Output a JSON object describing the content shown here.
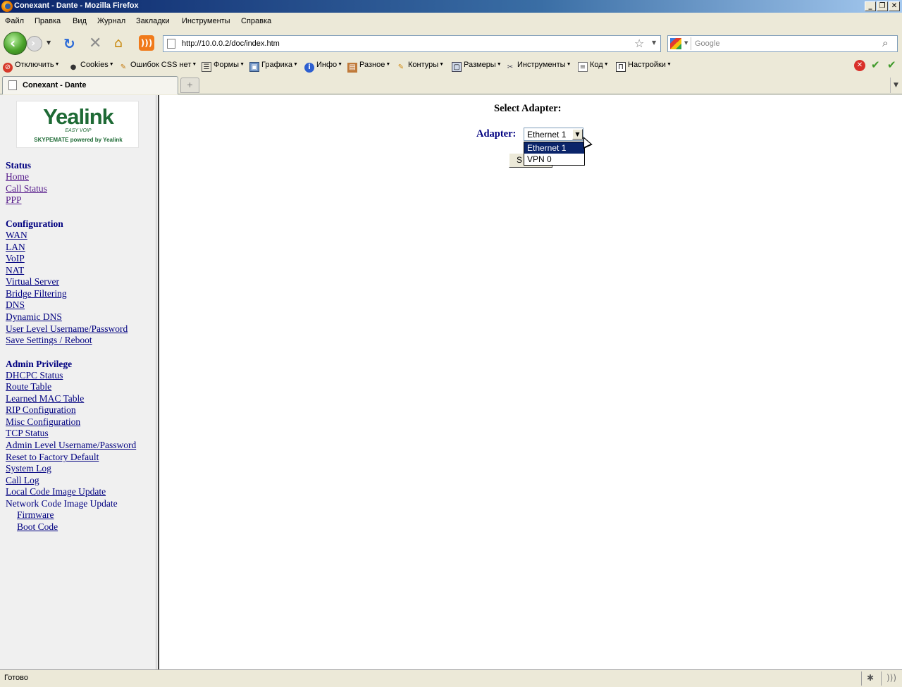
{
  "window": {
    "title": "Conexant - Dante - Mozilla Firefox"
  },
  "menu": [
    "Файл",
    "Правка",
    "Вид",
    "Журнал",
    "Закладки",
    "Инструменты",
    "Справка"
  ],
  "navigation": {
    "url": "http://10.0.0.2/doc/index.htm",
    "search_placeholder": "Google"
  },
  "toolbar": [
    "Отключить",
    "Cookies",
    "Ошибок CSS нет",
    "Формы",
    "Графика",
    "Инфо",
    "Разное",
    "Контуры",
    "Размеры",
    "Инструменты",
    "Код",
    "Настройки"
  ],
  "tabs": [
    {
      "label": "Conexant - Dante"
    }
  ],
  "logo": {
    "word": "Yealink",
    "tagline": "EASY VOIP",
    "sub": "SKYPEMATE powered by Yealink"
  },
  "sidebar": {
    "status": {
      "heading": "Status",
      "links": [
        "Home",
        "Call Status",
        "PPP"
      ]
    },
    "configuration": {
      "heading": "Configuration",
      "links": [
        "WAN",
        "LAN",
        "VoIP",
        "NAT",
        "Virtual Server",
        "Bridge Filtering",
        "DNS",
        "Dynamic DNS",
        "User Level Username/Password",
        "Save Settings / Reboot"
      ]
    },
    "admin": {
      "heading": "Admin Privilege",
      "links": [
        "DHCPC Status",
        "Route Table",
        "Learned MAC Table",
        "RIP Configuration",
        "Misc Configuration",
        "TCP Status",
        "Admin Level Username/Password",
        "Reset to Factory Default",
        "System Log",
        "Call Log",
        "Local Code Image Update"
      ],
      "network_update": "Network Code Image Update",
      "sublinks": [
        "Firmware",
        "Boot Code"
      ]
    }
  },
  "main": {
    "heading": "Select Adapter:",
    "adapter_label": "Adapter:",
    "selected": "Ethernet 1",
    "options": [
      "Ethernet 1",
      "VPN 0"
    ],
    "submit_visible": "S"
  },
  "statusbar": {
    "text": "Готово"
  }
}
